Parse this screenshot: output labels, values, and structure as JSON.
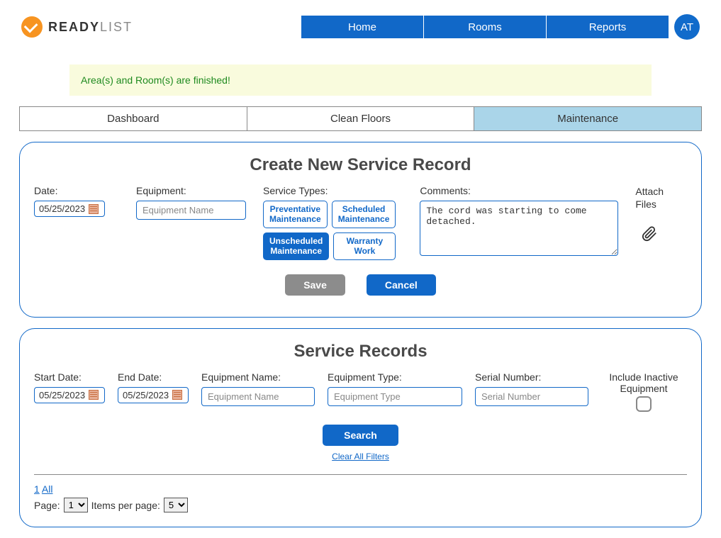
{
  "logo": {
    "brand_bold": "READY",
    "brand_light": "LIST"
  },
  "top_nav": {
    "home": "Home",
    "rooms": "Rooms",
    "reports": "Reports"
  },
  "avatar": "AT",
  "notice": "Area(s) and Room(s) are finished!",
  "tabs": {
    "dashboard": "Dashboard",
    "clean_floors": "Clean Floors",
    "maintenance": "Maintenance"
  },
  "create": {
    "title": "Create New Service Record",
    "date_label": "Date:",
    "date_value": "05/25/2023",
    "equipment_label": "Equipment:",
    "equipment_placeholder": "Equipment Name",
    "service_types_label": "Service Types:",
    "st_preventative": "Preventative Maintenance",
    "st_scheduled": "Scheduled Maintenance",
    "st_unscheduled": "Unscheduled Maintenance",
    "st_warranty": "Warranty Work",
    "comments_label": "Comments:",
    "comments_value": "The cord was starting to come detached.",
    "attach_label": "Attach Files",
    "save": "Save",
    "cancel": "Cancel"
  },
  "records": {
    "title": "Service Records",
    "start_date_label": "Start Date:",
    "start_date_value": "05/25/2023",
    "end_date_label": "End Date:",
    "end_date_value": "05/25/2023",
    "equip_name_label": "Equipment Name:",
    "equip_name_placeholder": "Equipment Name",
    "equip_type_label": "Equipment Type:",
    "equip_type_placeholder": "Equipment Type",
    "serial_label": "Serial Number:",
    "serial_placeholder": "Serial Number",
    "inactive_label": "Include Inactive Equipment",
    "search": "Search",
    "clear_filters": "Clear All Filters",
    "page_links_1": "1",
    "page_links_all": "All",
    "page_label": "Page:",
    "page_value": "1",
    "items_per_page_label": "Items per page:",
    "items_per_page_value": "5"
  }
}
